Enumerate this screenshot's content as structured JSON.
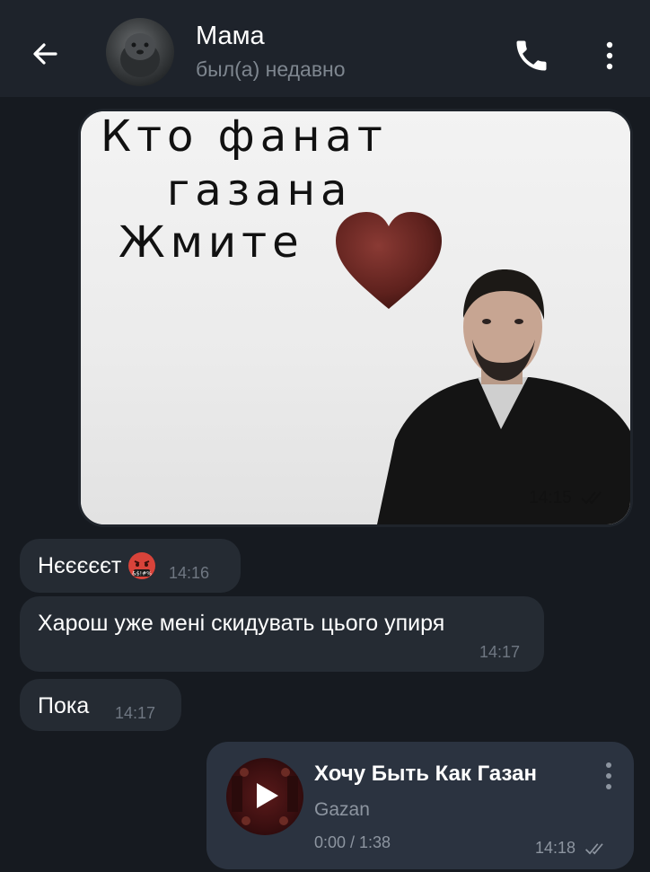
{
  "header": {
    "contact_name": "Мама",
    "status": "был(а) недавно",
    "icons": {
      "back": "arrow-left-icon",
      "call": "phone-icon",
      "menu": "more-vertical-icon"
    }
  },
  "sticker": {
    "lines": [
      "Кто фанат",
      "газана",
      "Жмите"
    ],
    "time": "14:15",
    "status_icon": "double-check-icon",
    "heart_color": "#6b2a26"
  },
  "messages": [
    {
      "text": "Нєєєєєт",
      "time": "14:16",
      "emoji": "angry-cursing-face-icon"
    },
    {
      "text": "Харош уже мені скидувать цього упиря",
      "time": "14:17"
    },
    {
      "text": "Пока",
      "time": "14:17"
    }
  ],
  "audio": {
    "title": "Хочу Быть Как Газан",
    "artist": "Gazan",
    "duration": "0:00 / 1:38",
    "time": "14:18",
    "status_icon": "double-check-icon",
    "play_icon": "play-icon",
    "menu_icon": "more-vertical-icon"
  },
  "colors": {
    "background": "#161a20",
    "header": "#1e232b",
    "incoming_bubble": "#252b33",
    "outgoing_bubble": "#2b3340",
    "muted_text": "#6f7782"
  }
}
